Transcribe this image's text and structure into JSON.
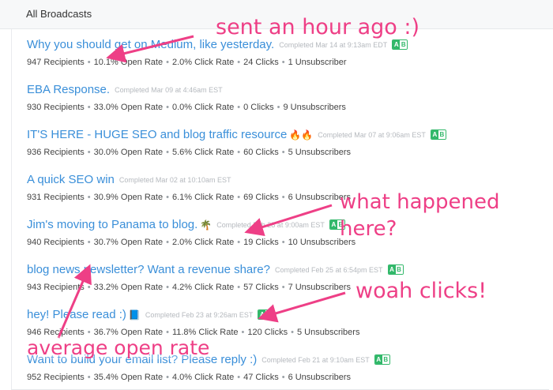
{
  "header": {
    "title": "All Broadcasts"
  },
  "broadcasts": [
    {
      "subject": "Why you should get on Medium, like yesterday.",
      "emoji": "",
      "completed": "Completed Mar 14 at 9:13am EDT",
      "ab": true,
      "stats": [
        "947 Recipients",
        "10.1% Open Rate",
        "2.0% Click Rate",
        "24 Clicks",
        "1 Unsubscriber"
      ]
    },
    {
      "subject": "EBA Response.",
      "emoji": "",
      "completed": "Completed Mar 09 at 4:46am EST",
      "ab": false,
      "stats": [
        "930 Recipients",
        "33.0% Open Rate",
        "0.0% Click Rate",
        "0 Clicks",
        "9 Unsubscribers"
      ]
    },
    {
      "subject": "IT'S HERE - HUGE SEO and blog traffic resource",
      "emoji": "🔥🔥",
      "completed": "Completed Mar 07 at 9:06am EST",
      "ab": true,
      "stats": [
        "936 Recipients",
        "30.0% Open Rate",
        "5.6% Click Rate",
        "60 Clicks",
        "5 Unsubscribers"
      ]
    },
    {
      "subject": "A quick SEO win",
      "emoji": "",
      "completed": "Completed Mar 02 at 10:10am EST",
      "ab": false,
      "stats": [
        "931 Recipients",
        "30.9% Open Rate",
        "6.1% Click Rate",
        "69 Clicks",
        "6 Unsubscribers"
      ]
    },
    {
      "subject": "Jim's moving to Panama to blog.",
      "emoji": "🌴",
      "completed": "Completed Feb 28 at 9:00am EST",
      "ab": true,
      "stats": [
        "940 Recipients",
        "30.7% Open Rate",
        "2.0% Click Rate",
        "19 Clicks",
        "10 Unsubscribers"
      ]
    },
    {
      "subject": "blog news newsletter? Want a revenue share?",
      "emoji": "",
      "completed": "Completed Feb 25 at 6:54pm EST",
      "ab": true,
      "stats": [
        "943 Recipients",
        "33.2% Open Rate",
        "4.2% Click Rate",
        "57 Clicks",
        "7 Unsubscribers"
      ]
    },
    {
      "subject": "hey! Please read :)",
      "emoji": "📘",
      "completed": "Completed Feb 23 at 9:26am EST",
      "ab": true,
      "stats": [
        "946 Recipients",
        "36.7% Open Rate",
        "11.8% Click Rate",
        "120 Clicks",
        "5 Unsubscribers"
      ]
    },
    {
      "subject": "Want to build your email list? Please reply :)",
      "emoji": "",
      "completed": "Completed Feb 21 at 9:10am EST",
      "ab": true,
      "stats": [
        "952 Recipients",
        "35.4% Open Rate",
        "4.0% Click Rate",
        "47 Clicks",
        "6 Unsubscribers"
      ]
    }
  ],
  "ab_badge": {
    "a": "A",
    "b": "B"
  },
  "annotations": {
    "sent": "sent an hour ago :)",
    "what": "what happened here?",
    "woah": "woah clicks!",
    "average": "average open rate"
  },
  "colors": {
    "annotation": "#ee3f86",
    "link": "#3a8fd9",
    "ab_badge": "#32b86a"
  }
}
